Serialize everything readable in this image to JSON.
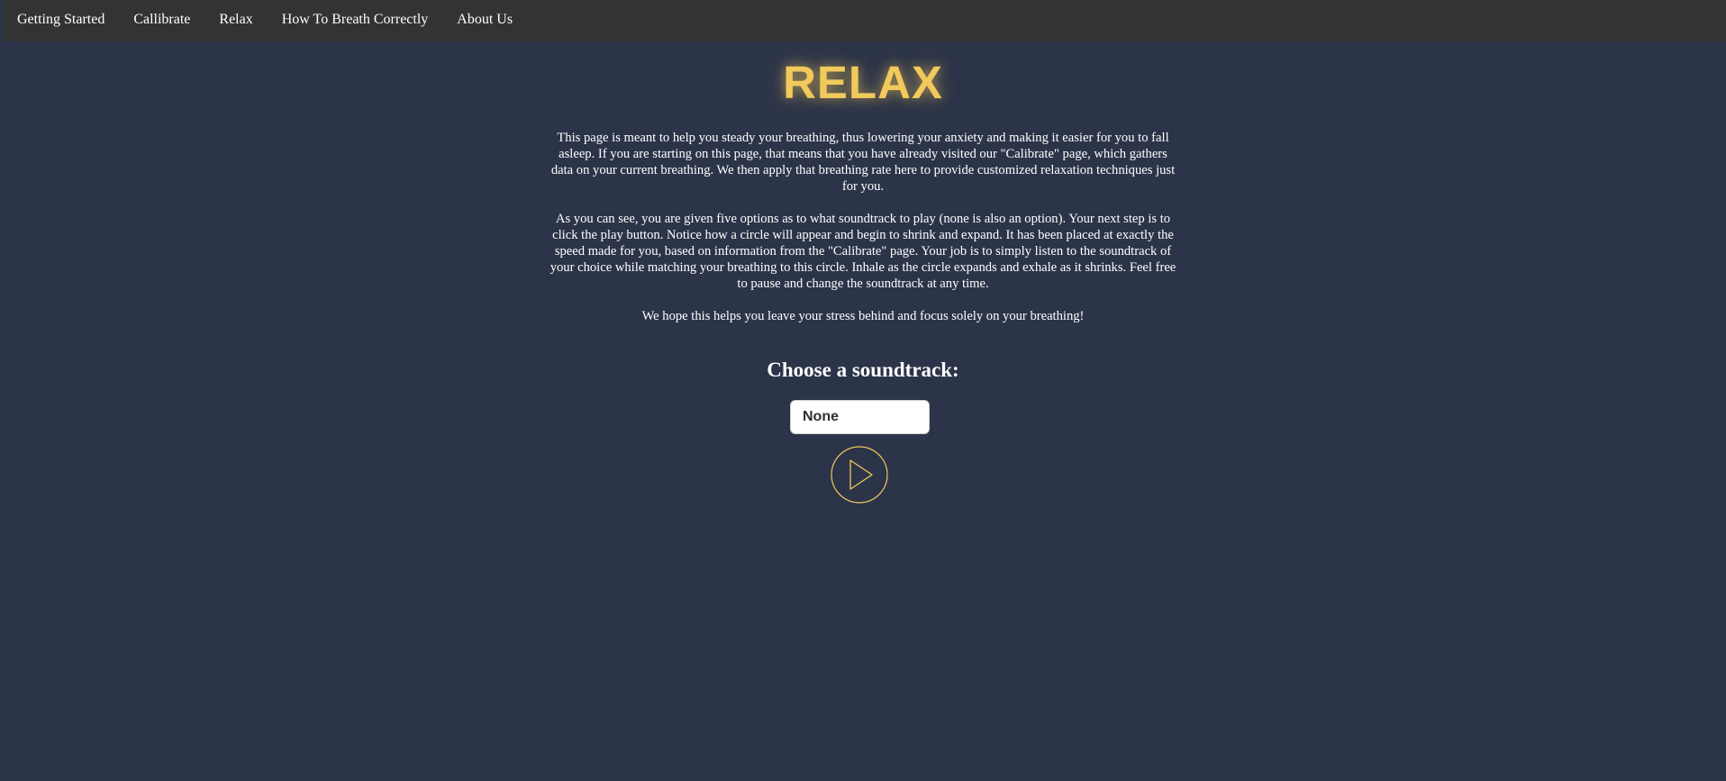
{
  "nav": {
    "items": [
      {
        "label": "Getting Started"
      },
      {
        "label": "Callibrate"
      },
      {
        "label": "Relax"
      },
      {
        "label": "How To Breath Correctly"
      },
      {
        "label": "About Us"
      }
    ]
  },
  "page": {
    "title": "RELAX",
    "paragraphs": [
      "This page is meant to help you steady your breathing, thus lowering your anxiety and making it easier for you to fall asleep. If you are starting on this page, that means that you have already visited our \"Calibrate\" page, which gathers data on your current breathing. We then apply that breathing rate here to provide customized relaxation techniques just for you.",
      "As you can see, you are given five options as to what soundtrack to play (none is also an option). Your next step is to click the play button. Notice how a circle will appear and begin to shrink and expand. It has been placed at exactly the speed made for you, based on information from the \"Calibrate\" page. Your job is to simply listen to the soundtrack of your choice while matching your breathing to this circle. Inhale as the circle expands and exhale as it shrinks. Feel free to pause and change the soundtrack at any time.",
      "We hope this helps you leave your stress behind and focus solely on your breathing!"
    ]
  },
  "soundtrack": {
    "heading": "Choose a soundtrack:",
    "selected": "None"
  },
  "player": {
    "play_icon": "play-icon"
  },
  "colors": {
    "background": "#2c3449",
    "nav_background": "#333333",
    "accent": "#f2c95b",
    "text": "#ffffff"
  }
}
